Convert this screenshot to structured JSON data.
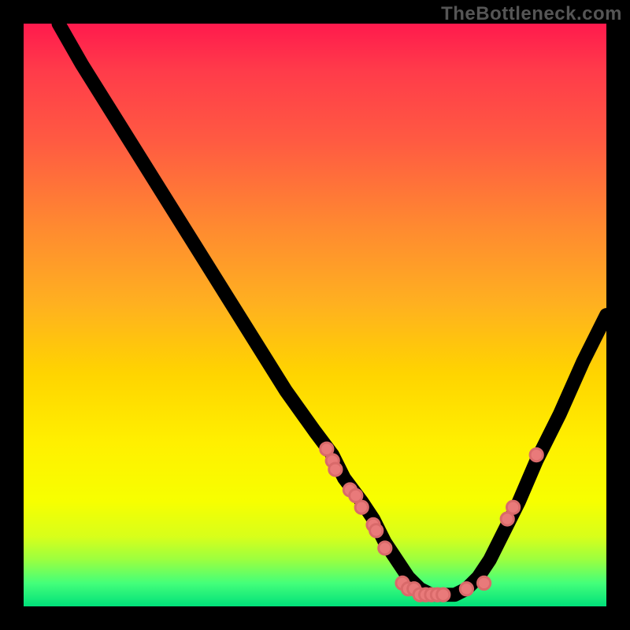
{
  "watermark": "TheBottleneck.com",
  "colors": {
    "dot": "#e97a7a",
    "curve": "#000000",
    "gradient_top": "#ff1a4d",
    "gradient_bottom": "#00e07a"
  },
  "chart_data": {
    "type": "line",
    "title": "",
    "xlabel": "",
    "ylabel": "",
    "xlim": [
      0,
      100
    ],
    "ylim": [
      0,
      100
    ],
    "note": "Axes are implicit (no tick labels visible). Values are estimated normalized 0-100 from pixel positions. y=0 is bottom (green), y=100 is top (red).",
    "series": [
      {
        "name": "curve",
        "x": [
          6,
          10,
          15,
          20,
          25,
          30,
          35,
          40,
          45,
          50,
          53,
          55,
          58,
          60,
          62,
          64,
          66,
          68,
          70,
          72,
          74,
          76,
          78,
          80,
          82,
          85,
          88,
          92,
          96,
          100
        ],
        "y": [
          100,
          93,
          85,
          77,
          69,
          61,
          53,
          45,
          37,
          30,
          26,
          22,
          18,
          15,
          11,
          8,
          5,
          3,
          2,
          2,
          2,
          3,
          5,
          8,
          12,
          18,
          25,
          33,
          42,
          50
        ]
      }
    ],
    "scatter_points": {
      "name": "markers",
      "note": "Pink dots clustered along the curve in the yellow/green band",
      "points": [
        {
          "x": 52,
          "y": 27
        },
        {
          "x": 53,
          "y": 25
        },
        {
          "x": 53.5,
          "y": 23.5
        },
        {
          "x": 56,
          "y": 20
        },
        {
          "x": 57,
          "y": 19
        },
        {
          "x": 58,
          "y": 17
        },
        {
          "x": 60,
          "y": 14
        },
        {
          "x": 60.5,
          "y": 13
        },
        {
          "x": 62,
          "y": 10
        },
        {
          "x": 65,
          "y": 4
        },
        {
          "x": 66,
          "y": 3
        },
        {
          "x": 67,
          "y": 3
        },
        {
          "x": 68,
          "y": 2
        },
        {
          "x": 69,
          "y": 2
        },
        {
          "x": 70,
          "y": 2
        },
        {
          "x": 71,
          "y": 2
        },
        {
          "x": 72,
          "y": 2
        },
        {
          "x": 76,
          "y": 3
        },
        {
          "x": 79,
          "y": 4
        },
        {
          "x": 83,
          "y": 15
        },
        {
          "x": 84,
          "y": 17
        },
        {
          "x": 88,
          "y": 26
        }
      ]
    }
  }
}
